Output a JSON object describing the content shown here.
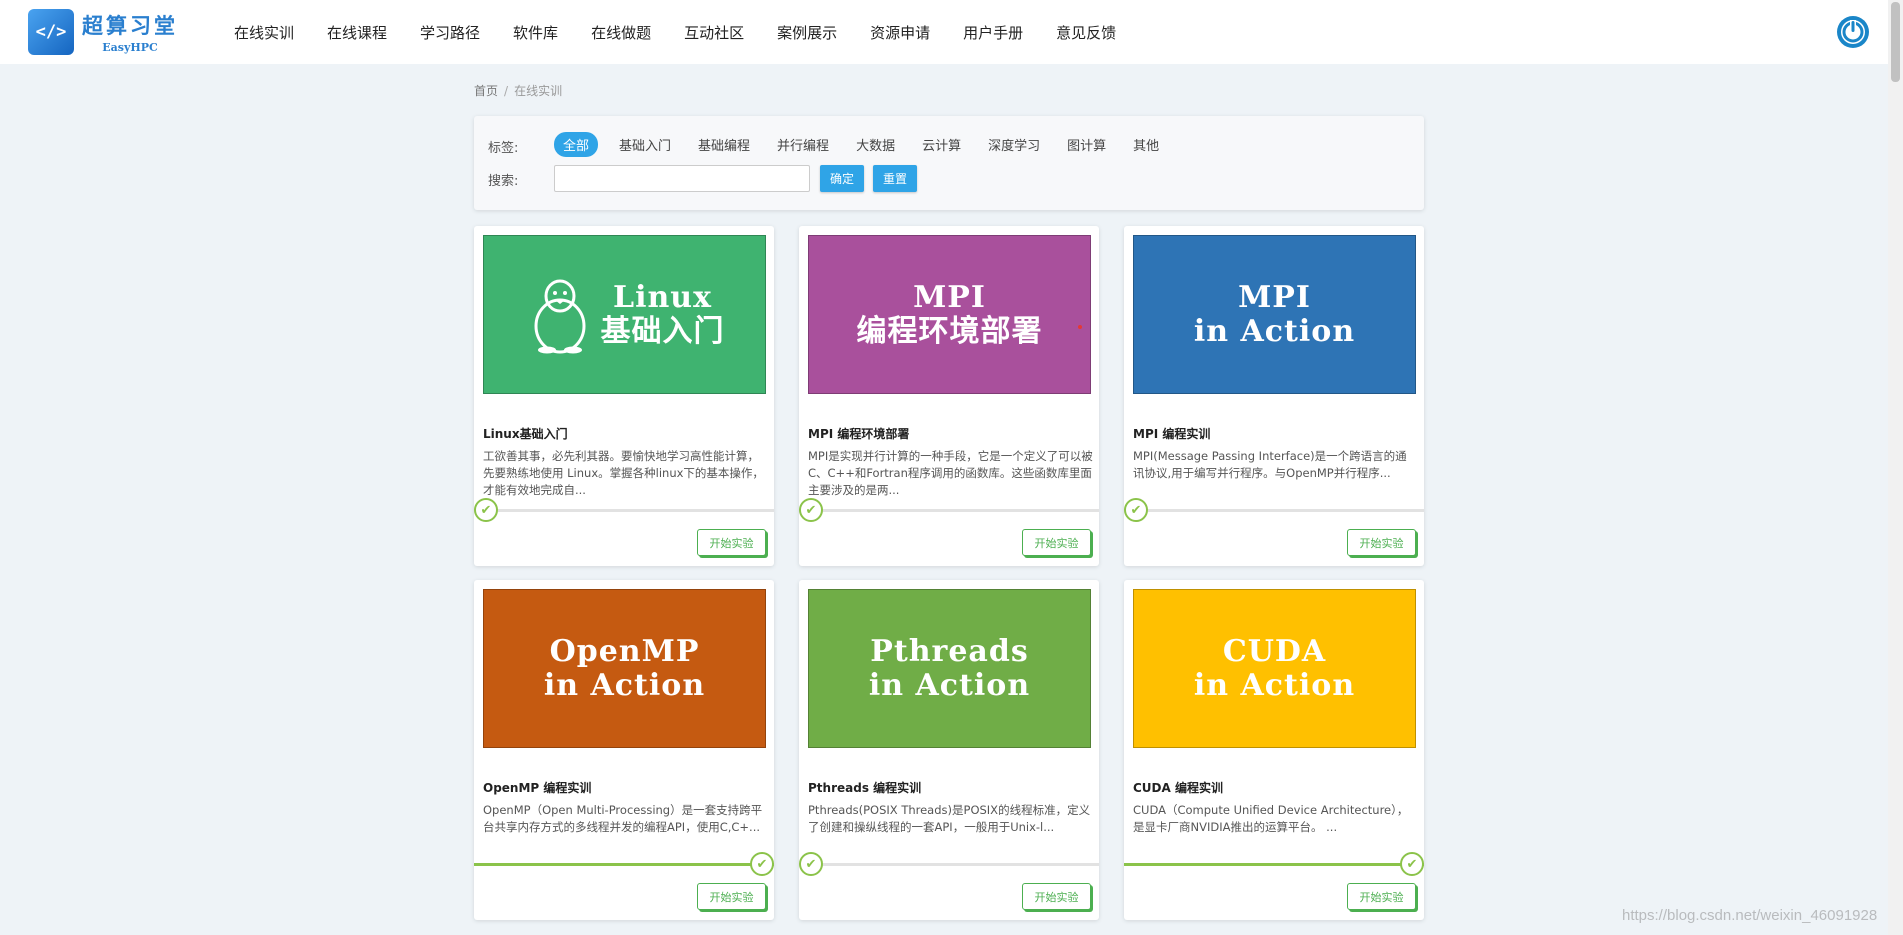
{
  "header": {
    "logo_icon": "</>",
    "logo_cn": "超算习堂",
    "logo_en": "EasyHPC",
    "nav": [
      "在线实训",
      "在线课程",
      "学习路径",
      "软件库",
      "在线做题",
      "互动社区",
      "案例展示",
      "资源申请",
      "用户手册",
      "意见反馈"
    ]
  },
  "breadcrumb": {
    "home": "首页",
    "separator": "/",
    "current": "在线实训"
  },
  "filter": {
    "tag_label": "标签:",
    "tags": [
      "全部",
      "基础入门",
      "基础编程",
      "并行编程",
      "大数据",
      "云计算",
      "深度学习",
      "图计算",
      "其他"
    ],
    "search_label": "搜索:",
    "search_value": "",
    "confirm": "确定",
    "reset": "重置"
  },
  "cards": [
    {
      "image_line1": "Linux",
      "image_line2": "基础入门",
      "image_color": "#3fb370",
      "title": "Linux基础入门",
      "desc": "工欲善其事，必先利其器。要愉快地学习高性能计算，先要熟练地使用 Linux。掌握各种linux下的基本操作，才能有效地完成自...",
      "progress": 0,
      "button": "开始实验"
    },
    {
      "image_line1": "MPI",
      "image_line2": "编程环境部署",
      "image_color": "#a9509c",
      "title": "MPI 编程环境部署",
      "desc": "MPI是实现并行计算的一种手段，它是一个定义了可以被C、C++和Fortran程序调用的函数库。这些函数库里面主要涉及的是两...",
      "progress": 0,
      "button": "开始实验"
    },
    {
      "image_line1": "MPI",
      "image_line2": "in Action",
      "image_color": "#2e74b5",
      "title": "MPI 编程实训",
      "desc": "MPI(Message Passing Interface)是一个跨语言的通讯协议,用于编写并行程序。与OpenMP并行程序...",
      "progress": 0,
      "button": "开始实验"
    },
    {
      "image_line1": "OpenMP",
      "image_line2": "in Action",
      "image_color": "#c55a11",
      "title": "OpenMP 编程实训",
      "desc": "OpenMP（Open Multi-Processing）是一套支持跨平台共享内存方式的多线程并发的编程API，使用C,C+...",
      "progress": 1,
      "button": "开始实验"
    },
    {
      "image_line1": "Pthreads",
      "image_line2": "in Action",
      "image_color": "#70ad47",
      "title": "Pthreads 编程实训",
      "desc": "Pthreads(POSIX Threads)是POSIX的线程标准，定义了创建和操纵线程的一套API，一般用于Unix-l...",
      "progress": 0,
      "button": "开始实验"
    },
    {
      "image_line1": "CUDA",
      "image_line2": "in Action",
      "image_color": "#ffc000",
      "title": "CUDA 编程实训",
      "desc": "CUDA（Compute Unified Device Architecture），是显卡厂商NVIDIA推出的运算平台。 ...",
      "progress": 1,
      "button": "开始实验"
    }
  ],
  "watermark": "https://blog.csdn.net/weixin_46091928",
  "colors": {
    "accent": "#2fa4e7",
    "progress": "#8bc34a",
    "start_button": "#4caf50"
  }
}
